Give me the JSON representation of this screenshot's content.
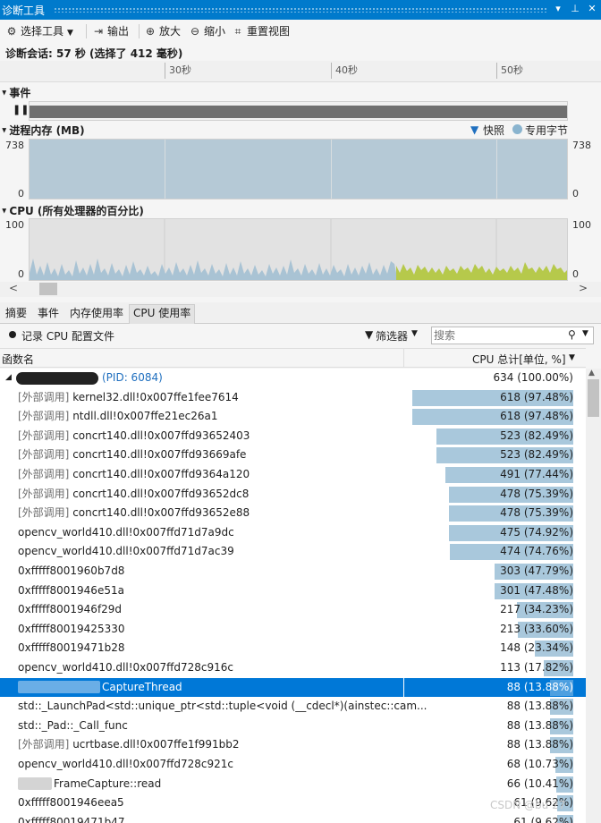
{
  "window": {
    "title": "诊断工具"
  },
  "toolbar": {
    "select_tools": "选择工具",
    "export": "输出",
    "zoom_in": "放大",
    "zoom_out": "缩小",
    "reset_view": "重置视图"
  },
  "session": {
    "text": "诊断会话: 57 秒 (选择了 412 毫秒)"
  },
  "ruler": {
    "ticks": [
      "30秒",
      "40秒",
      "50秒"
    ]
  },
  "events": {
    "title": "事件"
  },
  "memory": {
    "title": "进程内存 (MB)",
    "legend_snapshot": "快照",
    "legend_private": "专用字节",
    "max": "738",
    "min": "0",
    "level": 1.0
  },
  "cpu_graph": {
    "title": "CPU (所有处理器的百分比)",
    "max": "100",
    "min": "0"
  },
  "tabs": [
    "摘要",
    "事件",
    "内存使用率",
    "CPU 使用率"
  ],
  "cpu_panel": {
    "record_label": "记录 CPU 配置文件",
    "filter_label": "筛选器",
    "search_placeholder": "搜索"
  },
  "columns": {
    "function": "函数名",
    "cpu_total": "CPU 总计[单位, %]"
  },
  "root": {
    "pid": "(PID: 6084)",
    "value": "634 (100.00%)"
  },
  "rows": [
    {
      "prefix": "[外部调用]",
      "name": "kernel32.dll!0x007ffe1fee7614",
      "value": "618 (97.48%)",
      "frac": 0.9748
    },
    {
      "prefix": "[外部调用]",
      "name": "ntdll.dll!0x007ffe21ec26a1",
      "value": "618 (97.48%)",
      "frac": 0.9748
    },
    {
      "prefix": "[外部调用]",
      "name": "concrt140.dll!0x007ffd93652403",
      "value": "523 (82.49%)",
      "frac": 0.8249
    },
    {
      "prefix": "[外部调用]",
      "name": "concrt140.dll!0x007ffd93669afe",
      "value": "523 (82.49%)",
      "frac": 0.8249
    },
    {
      "prefix": "[外部调用]",
      "name": "concrt140.dll!0x007ffd9364a120",
      "value": "491 (77.44%)",
      "frac": 0.7744
    },
    {
      "prefix": "[外部调用]",
      "name": "concrt140.dll!0x007ffd93652dc8",
      "value": "478 (75.39%)",
      "frac": 0.7539
    },
    {
      "prefix": "[外部调用]",
      "name": "concrt140.dll!0x007ffd93652e88",
      "value": "478 (75.39%)",
      "frac": 0.7539
    },
    {
      "prefix": "",
      "name": "opencv_world410.dll!0x007ffd71d7a9dc",
      "value": "475 (74.92%)",
      "frac": 0.7492
    },
    {
      "prefix": "",
      "name": "opencv_world410.dll!0x007ffd71d7ac39",
      "value": "474 (74.76%)",
      "frac": 0.7476
    },
    {
      "prefix": "",
      "name": "0xfffff8001960b7d8",
      "value": "303 (47.79%)",
      "frac": 0.4779
    },
    {
      "prefix": "",
      "name": "0xfffff8001946e51a",
      "value": "301 (47.48%)",
      "frac": 0.4748
    },
    {
      "prefix": "",
      "name": "0xfffff8001946f29d",
      "value": "217 (34.23%)",
      "frac": 0.3423
    },
    {
      "prefix": "",
      "name": "0xfffff80019425330",
      "value": "213 (33.60%)",
      "frac": 0.336
    },
    {
      "prefix": "",
      "name": "0xfffff80019471b28",
      "value": "148 (23.34%)",
      "frac": 0.2334
    },
    {
      "prefix": "",
      "name": "opencv_world410.dll!0x007ffd728c916c",
      "value": "113 (17.82%)",
      "frac": 0.1782
    },
    {
      "prefix": "",
      "name": "CaptureThread",
      "value": "88 (13.88%)",
      "frac": 0.1388,
      "selected": true,
      "redacted": "light"
    },
    {
      "prefix": "",
      "name": "std::_LaunchPad<std::unique_ptr<std::tuple<void (__cdecl*)(ainstec::cam...",
      "value": "88 (13.88%)",
      "frac": 0.1388
    },
    {
      "prefix": "",
      "name": "std::_Pad::_Call_func",
      "value": "88 (13.88%)",
      "frac": 0.1388
    },
    {
      "prefix": "[外部调用]",
      "name": "ucrtbase.dll!0x007ffe1f991bb2",
      "value": "88 (13.88%)",
      "frac": 0.1388
    },
    {
      "prefix": "",
      "name": "opencv_world410.dll!0x007ffd728c921c",
      "value": "68 (10.73%)",
      "frac": 0.1073
    },
    {
      "prefix": "",
      "name": "FrameCapture::read",
      "value": "66 (10.41%)",
      "frac": 0.1041,
      "redacted": "gray"
    },
    {
      "prefix": "",
      "name": "0xfffff8001946eea5",
      "value": "61 (9.62%)",
      "frac": 0.0962
    },
    {
      "prefix": "",
      "name": "0xfffff80019471b47",
      "value": "61 (9.62%)",
      "frac": 0.0962
    }
  ],
  "watermark": "CSDN @bu 27"
}
